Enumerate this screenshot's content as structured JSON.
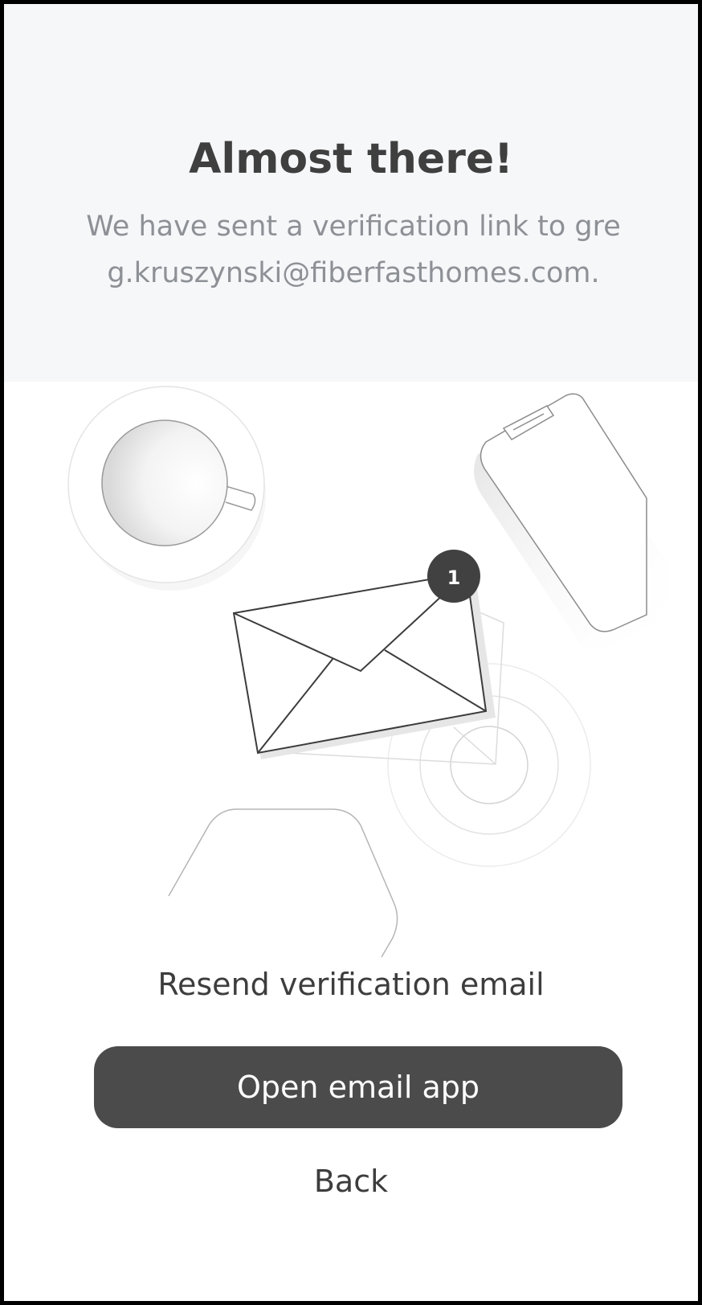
{
  "header": {
    "title": "Almost there!",
    "message": "We have sent a verification link to greg.kruszynski@fiberfasthomes.com."
  },
  "illustration": {
    "notification_count": "1",
    "icons": [
      "coffee-cup-icon",
      "smartphone-icon",
      "envelope-icon",
      "notification-badge",
      "concentric-circles-decor",
      "hexagon-decor"
    ]
  },
  "actions": {
    "resend_label": "Resend verification email",
    "open_email_label": "Open email app",
    "back_label": "Back"
  },
  "colors": {
    "primary_button": "#4b4b4b",
    "header_background": "#f6f7f9",
    "title": "#3f3f3f",
    "subtitle": "#8d9196"
  }
}
